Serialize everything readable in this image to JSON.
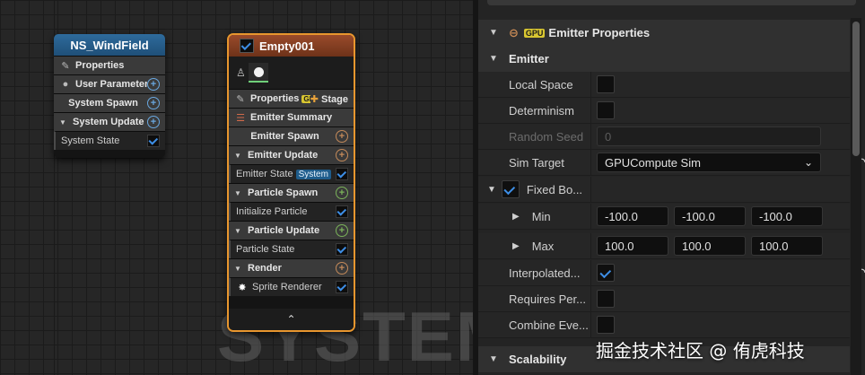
{
  "graph": {
    "watermark": "SYSTEM",
    "wind_node": {
      "title": "NS_WindField",
      "rows": [
        {
          "label": "Properties",
          "kind": "group"
        },
        {
          "label": "User Parameters",
          "kind": "group"
        },
        {
          "label": "System Spawn",
          "kind": "group"
        },
        {
          "label": "System Update",
          "kind": "group"
        },
        {
          "label": "System State",
          "kind": "item"
        }
      ]
    },
    "emitter_node": {
      "title": "Empty001",
      "properties_label": "Properties",
      "gpu_badge": "GPU",
      "stage_label": "Stage",
      "summary_label": "Emitter Summary",
      "emitter_spawn": "Emitter Spawn",
      "emitter_update": "Emitter Update",
      "emitter_state": "Emitter State",
      "system_tag": "System",
      "particle_spawn": "Particle Spawn",
      "initialize_particle": "Initialize Particle",
      "particle_update": "Particle Update",
      "particle_state": "Particle State",
      "render": "Render",
      "sprite_renderer": "Sprite Renderer",
      "footer_icon": "chevron-up-icon"
    }
  },
  "details": {
    "section_title": "Emitter Properties",
    "section_badge": "GPU",
    "emitter_category": "Emitter",
    "local_space": {
      "label": "Local Space",
      "checked": false
    },
    "determinism": {
      "label": "Determinism",
      "checked": false
    },
    "random_seed": {
      "label": "Random Seed",
      "value": "0"
    },
    "sim_target": {
      "label": "Sim Target",
      "value": "GPUCompute Sim"
    },
    "fixed_bounds": {
      "label": "Fixed Bo...",
      "checked": true
    },
    "min": {
      "label": "Min",
      "x": "-100.0",
      "y": "-100.0",
      "z": "-100.0"
    },
    "max": {
      "label": "Max",
      "x": "100.0",
      "y": "100.0",
      "z": "100.0"
    },
    "interpolated": {
      "label": "Interpolated...",
      "checked": true
    },
    "requires_per": {
      "label": "Requires Per...",
      "checked": false
    },
    "combine_eve": {
      "label": "Combine Eve...",
      "checked": false
    },
    "scalability_category": "Scalability"
  },
  "overlay_watermark": "掘金技术社区 @ 侑虎科技"
}
